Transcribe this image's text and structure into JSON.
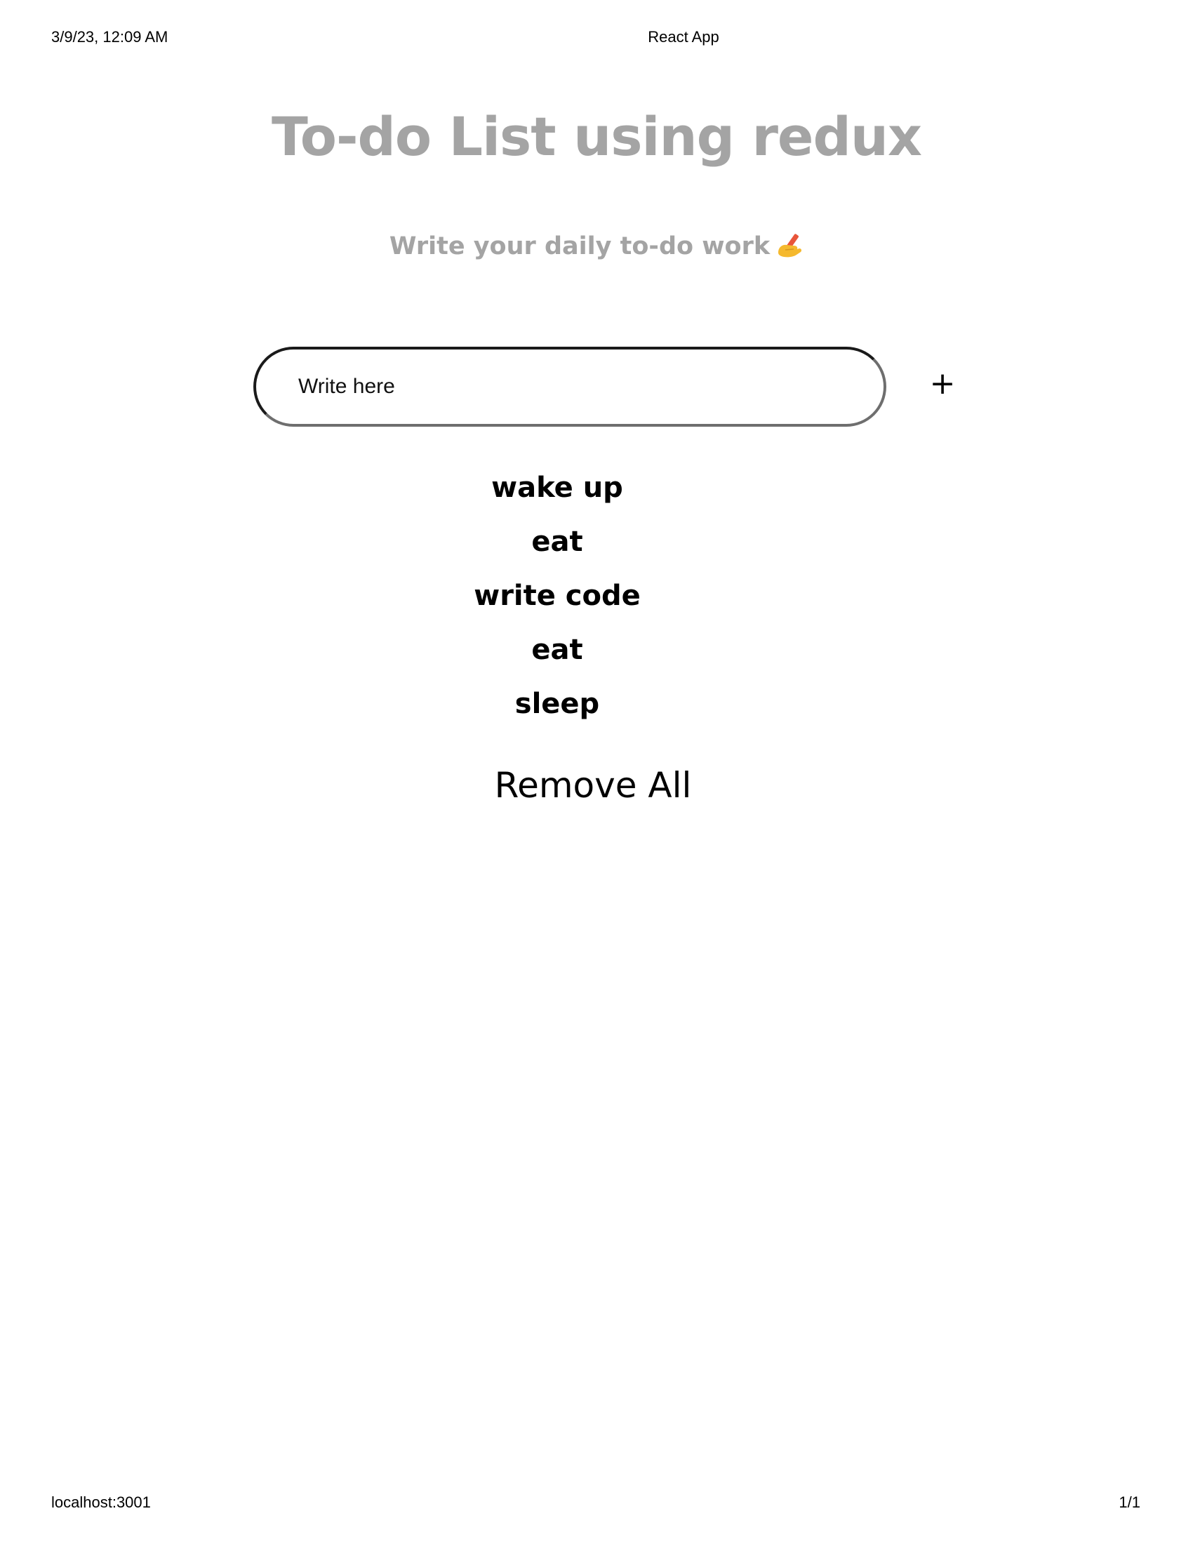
{
  "print_header": {
    "datetime": "3/9/23, 12:09 AM",
    "page_title": "React App"
  },
  "print_footer": {
    "url": "localhost:3001",
    "page_number": "1/1"
  },
  "app": {
    "title": "To-do List using redux",
    "subtitle": "Write your daily to-do work",
    "subtitle_icon": "writing-hand-emoji"
  },
  "input": {
    "placeholder": "Write here",
    "value": ""
  },
  "add_button": {
    "label": "+"
  },
  "todos": [
    "wake up",
    "eat",
    "write code",
    "eat",
    "sleep"
  ],
  "remove_all_button": {
    "label": "Remove All"
  },
  "colors": {
    "heading": "#a4a4a4",
    "text": "#000000",
    "input_border": "#1a1a1a",
    "emoji_skin": "#f5b92e",
    "emoji_pencil": "#e8553a"
  }
}
